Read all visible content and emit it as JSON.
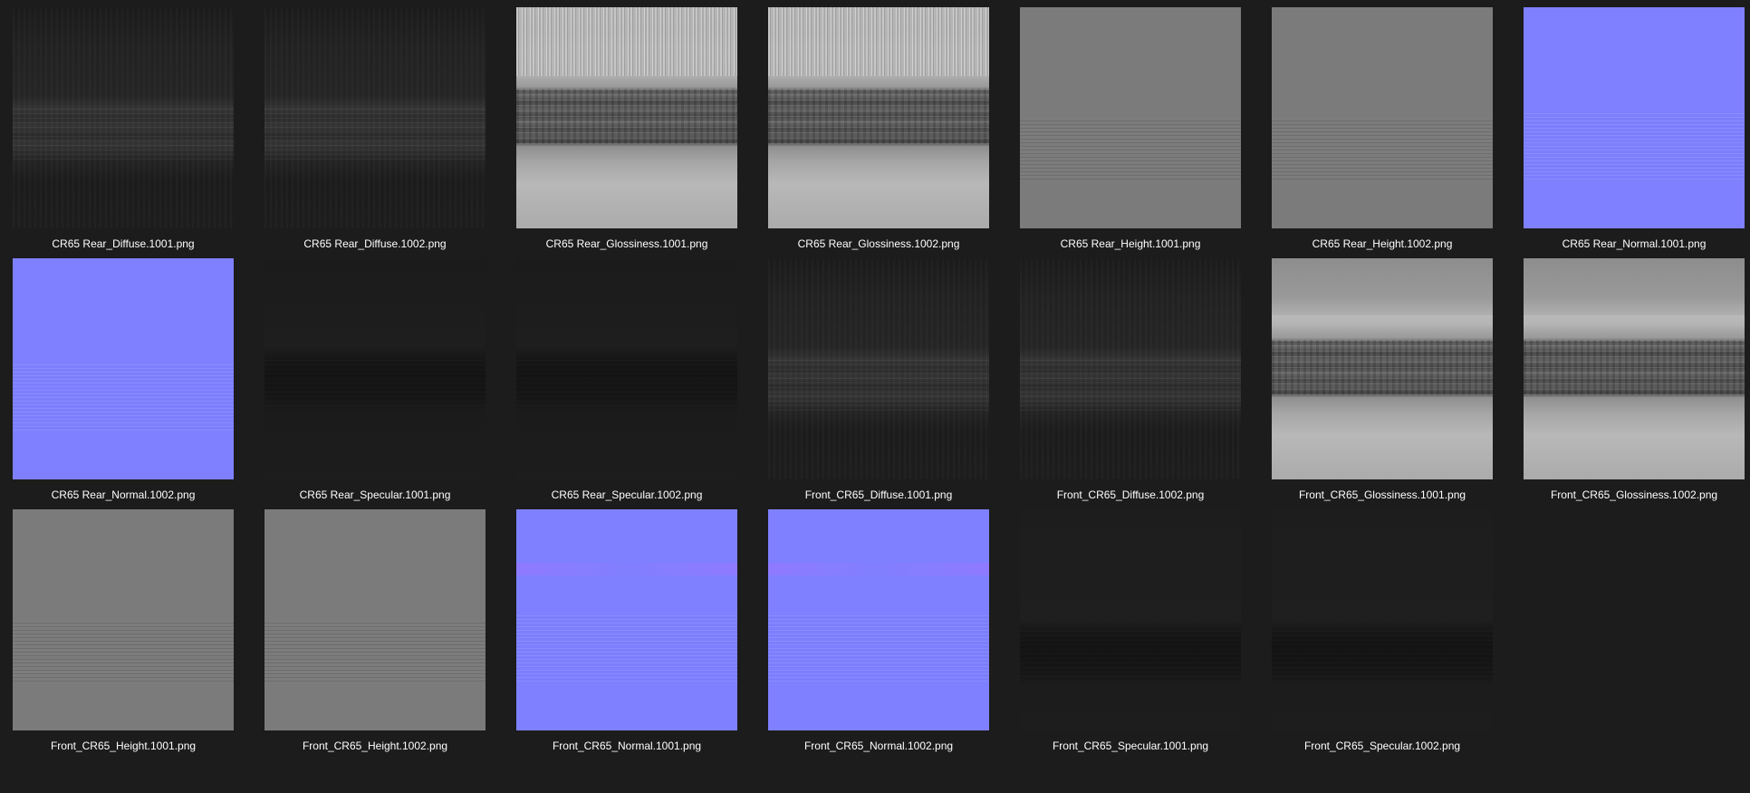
{
  "files": [
    {
      "name": "CR65 Rear_Diffuse.1001.png",
      "kind": "diffuse",
      "group": "rear"
    },
    {
      "name": "CR65 Rear_Diffuse.1002.png",
      "kind": "diffuse",
      "group": "rear"
    },
    {
      "name": "CR65 Rear_Glossiness.1001.png",
      "kind": "gloss",
      "group": "rear"
    },
    {
      "name": "CR65 Rear_Glossiness.1002.png",
      "kind": "gloss",
      "group": "rear"
    },
    {
      "name": "CR65 Rear_Height.1001.png",
      "kind": "height",
      "group": "rear"
    },
    {
      "name": "CR65 Rear_Height.1002.png",
      "kind": "height",
      "group": "rear"
    },
    {
      "name": "CR65 Rear_Normal.1001.png",
      "kind": "normal",
      "group": "rear"
    },
    {
      "name": "CR65 Rear_Normal.1002.png",
      "kind": "normal",
      "group": "rear"
    },
    {
      "name": "CR65 Rear_Specular.1001.png",
      "kind": "spec",
      "group": "rear"
    },
    {
      "name": "CR65 Rear_Specular.1002.png",
      "kind": "spec",
      "group": "rear"
    },
    {
      "name": "Front_CR65_Diffuse.1001.png",
      "kind": "diffuse",
      "group": "front"
    },
    {
      "name": "Front_CR65_Diffuse.1002.png",
      "kind": "diffuse",
      "group": "front"
    },
    {
      "name": "Front_CR65_Glossiness.1001.png",
      "kind": "gloss",
      "group": "front"
    },
    {
      "name": "Front_CR65_Glossiness.1002.png",
      "kind": "gloss",
      "group": "front"
    },
    {
      "name": "Front_CR65_Height.1001.png",
      "kind": "height",
      "group": "front"
    },
    {
      "name": "Front_CR65_Height.1002.png",
      "kind": "height",
      "group": "front"
    },
    {
      "name": "Front_CR65_Normal.1001.png",
      "kind": "normal",
      "group": "front"
    },
    {
      "name": "Front_CR65_Normal.1002.png",
      "kind": "normal",
      "group": "front"
    },
    {
      "name": "Front_CR65_Specular.1001.png",
      "kind": "spec",
      "group": "front"
    },
    {
      "name": "Front_CR65_Specular.1002.png",
      "kind": "spec",
      "group": "front"
    }
  ],
  "colors": {
    "background": "#1c1c1c",
    "label_text": "#ffffff",
    "normal_map_blue": "#7f80ff"
  }
}
